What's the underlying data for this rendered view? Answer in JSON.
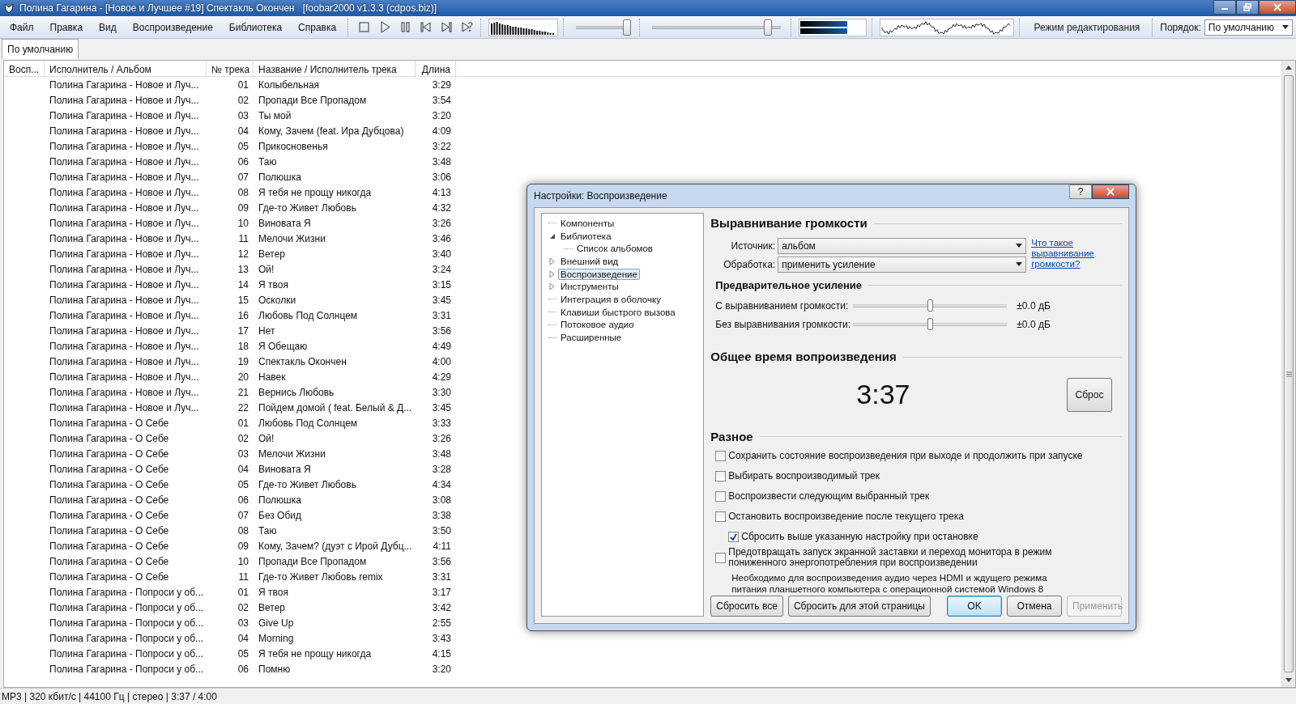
{
  "window": {
    "title": "Полина Гагарина - [Новое и Лучшее #19] Спектакль Окончен   [foobar2000 v1.3.3 (cdpos.biz)]"
  },
  "menu": [
    "Файл",
    "Правка",
    "Вид",
    "Воспроизведение",
    "Библиотека",
    "Справка"
  ],
  "toolbar": {
    "volume": {
      "level": 0.95
    },
    "seek": {
      "level": 0.9
    },
    "edit_mode_button": "Режим редактирования",
    "order_label": "Порядок:",
    "order_value": "По умолчанию"
  },
  "playlist_tabs": [
    {
      "label": "По умолчанию",
      "selected": true
    }
  ],
  "playlist": {
    "columns": [
      "Восп...",
      "Исполнитель / Альбом",
      "№ трека",
      "Название / Исполнитель трека",
      "Длина"
    ],
    "rows": [
      {
        "artist": "Полина Гагарина - Новое и Луч...",
        "no": "01",
        "title": "Колыбельная",
        "length": "3:29"
      },
      {
        "artist": "Полина Гагарина - Новое и Луч...",
        "no": "02",
        "title": "Пропади Все Пропадом",
        "length": "3:54"
      },
      {
        "artist": "Полина Гагарина - Новое и Луч...",
        "no": "03",
        "title": "Ты мой",
        "length": "3:20"
      },
      {
        "artist": "Полина Гагарина - Новое и Луч...",
        "no": "04",
        "title": "Кому, Зачем (feat. Ира Дубцова)",
        "length": "4:09"
      },
      {
        "artist": "Полина Гагарина - Новое и Луч...",
        "no": "05",
        "title": "Прикосновенья",
        "length": "3:22"
      },
      {
        "artist": "Полина Гагарина - Новое и Луч...",
        "no": "06",
        "title": "Таю",
        "length": "3:48"
      },
      {
        "artist": "Полина Гагарина - Новое и Луч...",
        "no": "07",
        "title": "Полюшка",
        "length": "3:06"
      },
      {
        "artist": "Полина Гагарина - Новое и Луч...",
        "no": "08",
        "title": "Я тебя не прощу никогда",
        "length": "4:13"
      },
      {
        "artist": "Полина Гагарина - Новое и Луч...",
        "no": "09",
        "title": "Где-то Живет Любовь",
        "length": "4:32"
      },
      {
        "artist": "Полина Гагарина - Новое и Луч...",
        "no": "10",
        "title": "Виновата Я",
        "length": "3:26"
      },
      {
        "artist": "Полина Гагарина - Новое и Луч...",
        "no": "11",
        "title": "Мелочи Жизни",
        "length": "3:46"
      },
      {
        "artist": "Полина Гагарина - Новое и Луч...",
        "no": "12",
        "title": "Ветер",
        "length": "3:40"
      },
      {
        "artist": "Полина Гагарина - Новое и Луч...",
        "no": "13",
        "title": "Ой!",
        "length": "3:24"
      },
      {
        "artist": "Полина Гагарина - Новое и Луч...",
        "no": "14",
        "title": "Я твоя",
        "length": "3:15"
      },
      {
        "artist": "Полина Гагарина - Новое и Луч...",
        "no": "15",
        "title": "Осколки",
        "length": "3:45"
      },
      {
        "artist": "Полина Гагарина - Новое и Луч...",
        "no": "16",
        "title": "Любовь Под Солнцем",
        "length": "3:31"
      },
      {
        "artist": "Полина Гагарина - Новое и Луч...",
        "no": "17",
        "title": "Нет",
        "length": "3:56"
      },
      {
        "artist": "Полина Гагарина - Новое и Луч...",
        "no": "18",
        "title": "Я Обещаю",
        "length": "4:49"
      },
      {
        "artist": "Полина Гагарина - Новое и Луч...",
        "no": "19",
        "title": "Спектакль Окончен",
        "length": "4:00"
      },
      {
        "artist": "Полина Гагарина - Новое и Луч...",
        "no": "20",
        "title": "Навек",
        "length": "4:29"
      },
      {
        "artist": "Полина Гагарина - Новое и Луч...",
        "no": "21",
        "title": "Вернись Любовь",
        "length": "3:30"
      },
      {
        "artist": "Полина Гагарина - Новое и Луч...",
        "no": "22",
        "title": "Пойдем домой ( feat. Белый & Д...",
        "length": "3:45"
      },
      {
        "artist": "Полина Гагарина - О Себе",
        "no": "01",
        "title": "Любовь Под Солнцем",
        "length": "3:33"
      },
      {
        "artist": "Полина Гагарина - О Себе",
        "no": "02",
        "title": "Ой!",
        "length": "3:26"
      },
      {
        "artist": "Полина Гагарина - О Себе",
        "no": "03",
        "title": "Мелочи Жизни",
        "length": "3:48"
      },
      {
        "artist": "Полина Гагарина - О Себе",
        "no": "04",
        "title": "Виновата Я",
        "length": "3:28"
      },
      {
        "artist": "Полина Гагарина - О Себе",
        "no": "05",
        "title": "Где-то Живет Любовь",
        "length": "4:34"
      },
      {
        "artist": "Полина Гагарина - О Себе",
        "no": "06",
        "title": "Полюшка",
        "length": "3:08"
      },
      {
        "artist": "Полина Гагарина - О Себе",
        "no": "07",
        "title": "Без Обид",
        "length": "3:38"
      },
      {
        "artist": "Полина Гагарина - О Себе",
        "no": "08",
        "title": "Таю",
        "length": "3:50"
      },
      {
        "artist": "Полина Гагарина - О Себе",
        "no": "09",
        "title": "Кому, Зачем? (дуэт с Ирой Дубц...",
        "length": "4:11"
      },
      {
        "artist": "Полина Гагарина - О Себе",
        "no": "10",
        "title": "Пропади Все Пропадом",
        "length": "3:56"
      },
      {
        "artist": "Полина Гагарина - О Себе",
        "no": "11",
        "title": "Где-то Живет Любовь remix",
        "length": "3:31"
      },
      {
        "artist": "Полина Гагарина - Попроси у об...",
        "no": "01",
        "title": "Я твоя",
        "length": "3:17"
      },
      {
        "artist": "Полина Гагарина - Попроси у об...",
        "no": "02",
        "title": "Ветер",
        "length": "3:42"
      },
      {
        "artist": "Полина Гагарина - Попроси у об...",
        "no": "03",
        "title": "Give Up",
        "length": "2:55"
      },
      {
        "artist": "Полина Гагарина - Попроси у об...",
        "no": "04",
        "title": "Morning",
        "length": "3:43"
      },
      {
        "artist": "Полина Гагарина - Попроси у об...",
        "no": "05",
        "title": "Я тебя не прощу никогда",
        "length": "4:15"
      },
      {
        "artist": "Полина Гагарина - Попроси у об...",
        "no": "06",
        "title": "Помню",
        "length": "3:20"
      }
    ]
  },
  "status_bar": "MP3 | 320 кбит/с | 44100 Гц | стерео | 3:37 / 4:00",
  "dialog": {
    "title": "Настройки: Воспроизведение",
    "help": "?",
    "tree": [
      {
        "label": "Компоненты",
        "kind": "leaf",
        "selected": false
      },
      {
        "label": "Библиотека",
        "kind": "branch",
        "expanded": true,
        "selected": false,
        "children": [
          {
            "label": "Список альбомов",
            "kind": "leaf",
            "selected": false
          }
        ]
      },
      {
        "label": "Внешний вид",
        "kind": "branch",
        "expanded": false,
        "selected": false
      },
      {
        "label": "Воспроизведение",
        "kind": "branch",
        "expanded": false,
        "selected": true
      },
      {
        "label": "Инструменты",
        "kind": "branch",
        "expanded": false,
        "selected": false
      },
      {
        "label": "Интеграция в оболочку",
        "kind": "leaf",
        "selected": false
      },
      {
        "label": "Клавиши быстрого вызова",
        "kind": "leaf",
        "selected": false
      },
      {
        "label": "Потоковое аудио",
        "kind": "leaf",
        "selected": false
      },
      {
        "label": "Расширенные",
        "kind": "leaf",
        "selected": false
      }
    ],
    "replaygain": {
      "heading": "Выравнивание громкости",
      "source_label": "Источник:",
      "source_value": "альбом",
      "processing_label": "Обработка:",
      "processing_value": "применить усиление",
      "help_link": "Что такое выравнивание громкости?"
    },
    "preamp": {
      "heading": "Предварительное усиление",
      "sliders": [
        {
          "label": "С выравниванием громкости:",
          "level": 0.5,
          "reading": "±0.0 дБ"
        },
        {
          "label": "Без выравнивания громкости:",
          "level": 0.5,
          "reading": "±0.0 дБ"
        }
      ]
    },
    "playtime": {
      "heading": "Общее время вопроизведения",
      "value": "3:37",
      "reset_button": "Сброс"
    },
    "misc": {
      "heading": "Разное",
      "options": [
        {
          "label": "Сохранить состояние воспроизведения при выходе и продолжить при запуске",
          "checked": false
        },
        {
          "label": "Выбирать воспроизводимый трек",
          "checked": false
        },
        {
          "label": "Воспроизвести следующим выбранный трек",
          "checked": false
        },
        {
          "label": "Остановить воспроизведение после текущего трека",
          "checked": false,
          "children": [
            {
              "label": "Сбросить выше указанную настройку при остановке",
              "checked": true
            }
          ]
        },
        {
          "label": "Предотвращать запуск экранной заставки и переход монитора в режим пониженного энергопотребления при воспроизведении",
          "checked": false
        }
      ],
      "note": "Необходимо для воспроизведения аудио через HDMI и ждущего режима питания планшетного компьютера с операционной системой Windows 8"
    },
    "buttons": [
      {
        "label": "Сбросить все",
        "kind": "normal",
        "disabled": false
      },
      {
        "label": "Сбросить для этой страницы",
        "kind": "normal",
        "disabled": false
      },
      {
        "label": "OK",
        "kind": "default",
        "disabled": false
      },
      {
        "label": "Отмена",
        "kind": "normal",
        "disabled": false
      },
      {
        "label": "Применить",
        "kind": "normal",
        "disabled": true
      }
    ]
  }
}
